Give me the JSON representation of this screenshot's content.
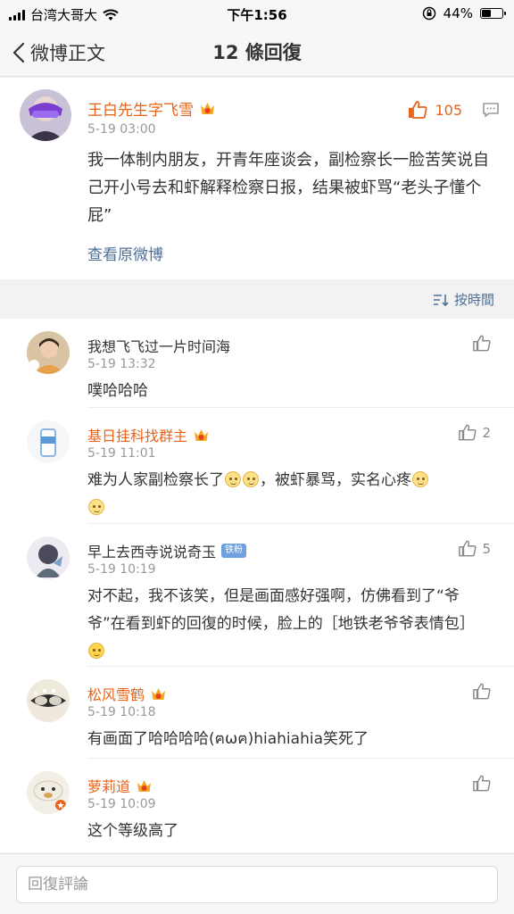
{
  "status_bar": {
    "carrier": "台湾大哥大",
    "time": "下午1:56",
    "battery": "44%",
    "battery_level": 0.44
  },
  "nav": {
    "back_label": "微博正文",
    "title": "12 條回復"
  },
  "post": {
    "username": "王白先生字飞雪",
    "time": "5-19 03:00",
    "like_count": "105",
    "content": "我一体制内朋友，开青年座谈会，副检察长一脸苦笑说自己开小号去和虾解释检察日报，结果被虾骂“老头子懂个屁”",
    "view_original": "查看原微博"
  },
  "sort": {
    "label": "按時間"
  },
  "comments": [
    {
      "username": "我想飞飞过一片时间海",
      "time": "5-19 13:32",
      "text_parts": [
        "噗哈哈哈"
      ],
      "likes": "",
      "name_color": "plain",
      "vip": false,
      "badge": ""
    },
    {
      "username": "基日挂科找群主",
      "time": "5-19 11:01",
      "text_parts": [
        "难为人家副检察长了",
        "，被虾暴骂，实名心疼"
      ],
      "likes": "2",
      "name_color": "orange",
      "vip": true,
      "badge": ""
    },
    {
      "username": "早上去西寺说说奇玉",
      "time": "5-19 10:19",
      "text_parts": [
        "对不起，我不该笑，但是画面感好强啊，仿佛看到了“爷爷”在看到虾的回復的时候，脸上的［地铁老爷爷表情包］"
      ],
      "likes": "5",
      "name_color": "plain",
      "vip": false,
      "badge": "铁粉"
    },
    {
      "username": "松风雪鹤",
      "time": "5-19 10:18",
      "text_parts": [
        "有画面了哈哈哈哈(ฅωฅ)hiahiahia笑死了"
      ],
      "likes": "",
      "name_color": "orange",
      "vip": true,
      "badge": ""
    },
    {
      "username": "萝莉道",
      "time": "5-19 10:09",
      "text_parts": [
        "这个等级高了"
      ],
      "likes": "",
      "name_color": "orange",
      "vip": true,
      "badge": ""
    }
  ],
  "bottom": {
    "reply_placeholder": "回復評論"
  },
  "colors": {
    "orange_name": "#e8631a",
    "link_blue": "#4d6f97",
    "like_orange": "#e8631a"
  }
}
